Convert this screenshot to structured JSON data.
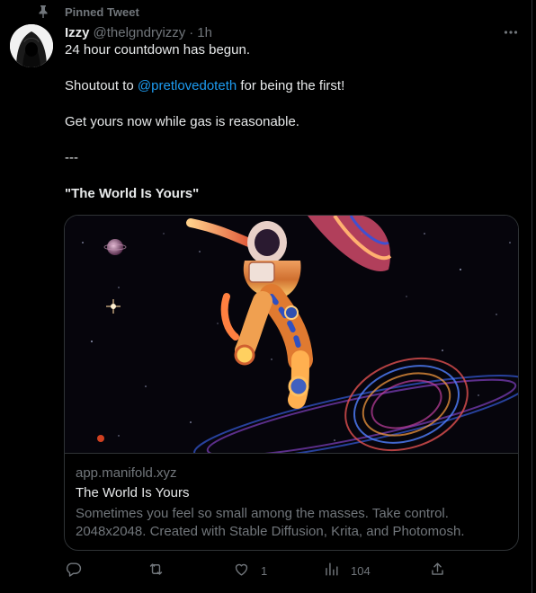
{
  "pinned_label": "Pinned Tweet",
  "author": {
    "name": "Izzy",
    "handle": "@thelgndryizzy",
    "separator": "·",
    "time": "1h"
  },
  "body": {
    "line1": "24 hour countdown has begun.",
    "line2_prefix": "Shoutout to ",
    "line2_mention": "@pretlovedoteth",
    "line2_suffix": " for being the first!",
    "line3": "Get yours now while gas is reasonable.",
    "divider": "---",
    "quote_title": "\"The World Is Yours\""
  },
  "card": {
    "domain": "app.manifold.xyz",
    "title": "The World Is Yours",
    "description": "Sometimes you feel so small among the masses. Take control. 2048x2048. Created with Stable Diffusion, Krita, and Photomosh."
  },
  "actions": {
    "reply_count": "",
    "retweet_count": "",
    "like_count": "1",
    "views_count": "104"
  },
  "colors": {
    "background": "#000000",
    "text": "#e7e9ea",
    "muted": "#71767b",
    "accent": "#1d9bf0",
    "border": "#2f3336"
  },
  "icons": [
    "pin-icon",
    "more-icon",
    "reply-icon",
    "retweet-icon",
    "like-icon",
    "views-icon",
    "share-icon"
  ]
}
